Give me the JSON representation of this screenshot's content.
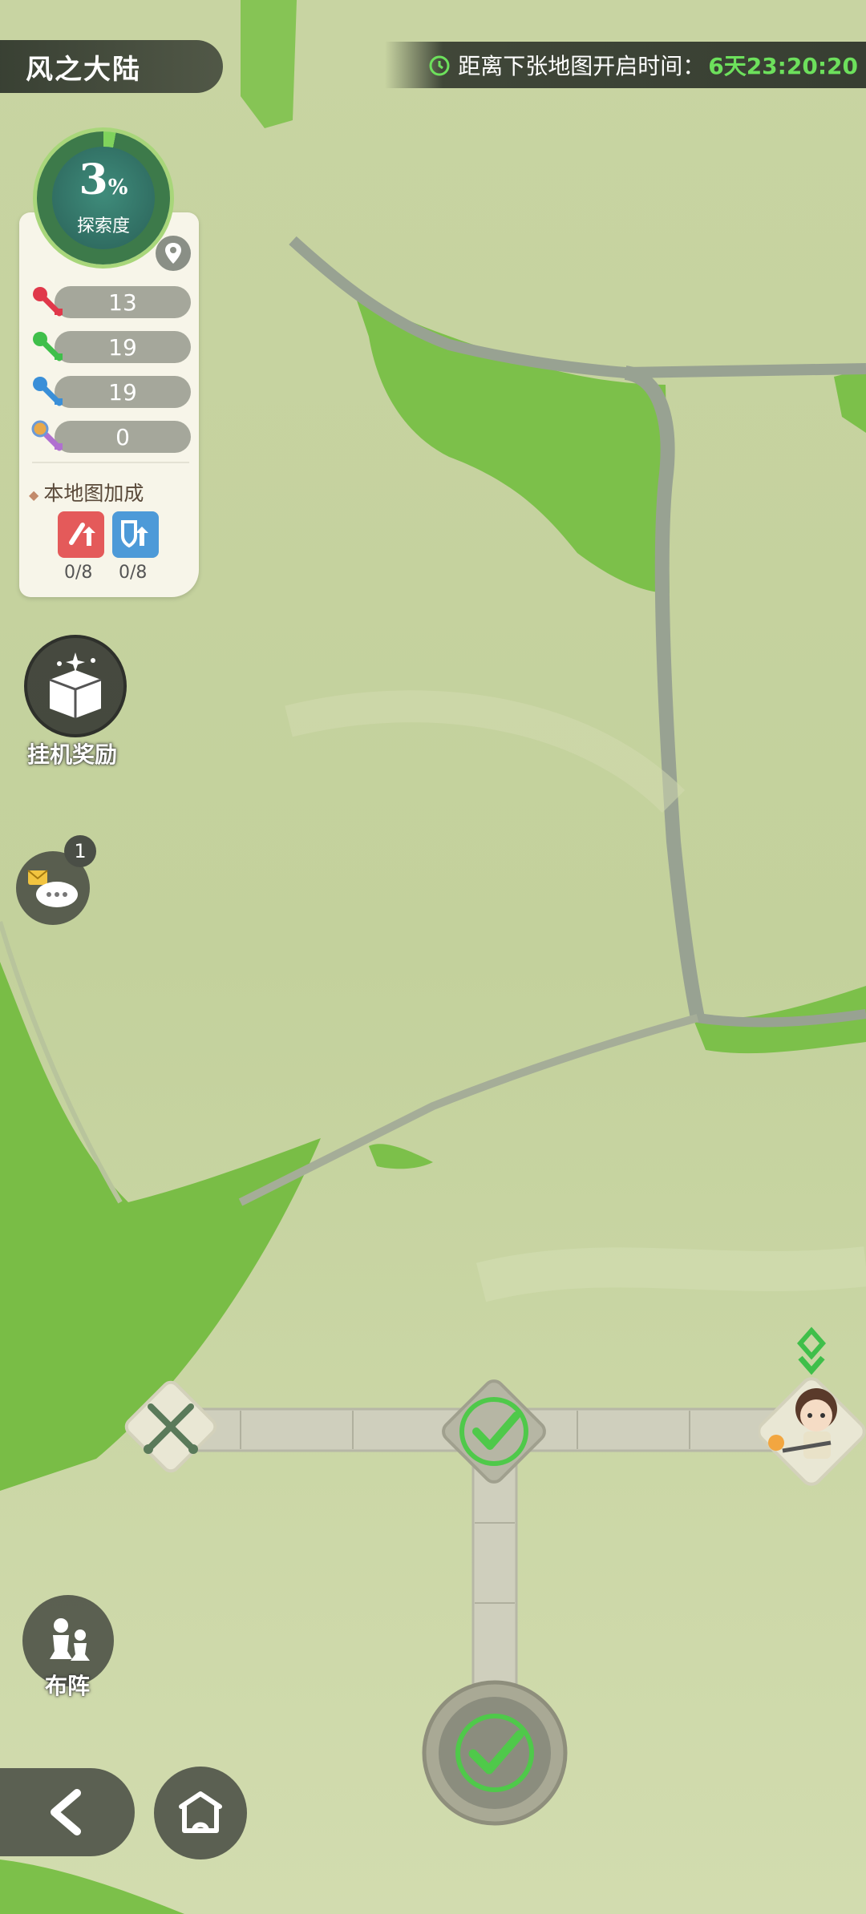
{
  "header": {
    "region_title": "风之大陆",
    "timer_label": "距离下张地图开启时间：",
    "timer_value": "6天23:20:20"
  },
  "exploration": {
    "percent": "3",
    "percent_sign": "%",
    "label": "探索度",
    "progress_fraction": 0.03
  },
  "keys": [
    {
      "name": "red-key",
      "count": "13",
      "color": "#e0384a"
    },
    {
      "name": "green-key",
      "count": "19",
      "color": "#3fbf4a"
    },
    {
      "name": "blue-key",
      "count": "19",
      "color": "#3a8fd8"
    },
    {
      "name": "rainbow-key",
      "count": "0",
      "color": "#b070d0"
    }
  ],
  "map_bonus": {
    "title": "本地图加成",
    "items": [
      {
        "type": "attack-up",
        "count": "0/8",
        "color": "#e45a5a"
      },
      {
        "type": "defense-up",
        "count": "0/8",
        "color": "#4d9ad8"
      }
    ]
  },
  "side_buttons": {
    "idle_reward": "挂机奖励",
    "message_badge": "1",
    "formation": "布阵"
  },
  "colors": {
    "map_base": "#cdd8a8",
    "grass": "#7cc04a",
    "path": "#cfcfbd",
    "accent_green": "#6de05c"
  }
}
